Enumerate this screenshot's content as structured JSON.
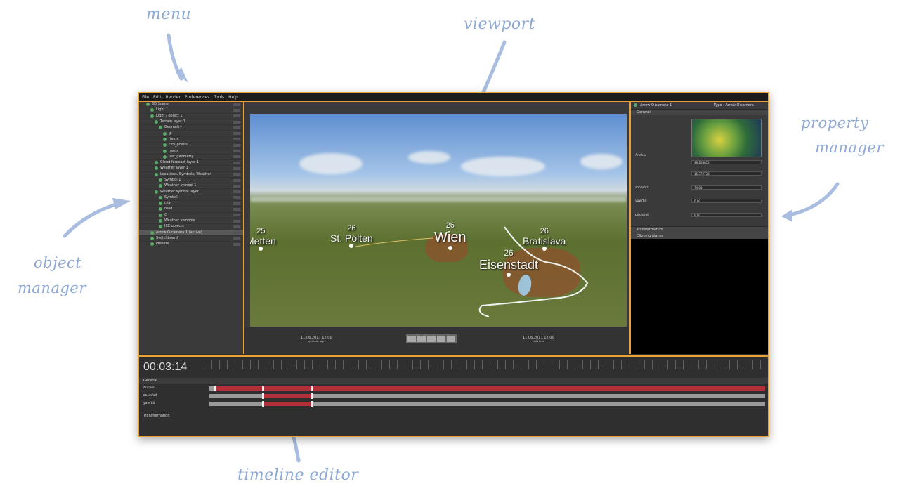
{
  "annotations": {
    "menu": "menu",
    "viewport": "viewport",
    "property_manager_line1": "property",
    "property_manager_line2": "manager",
    "object_manager_line1": "object",
    "object_manager_line2": "manager",
    "timeline_editor": "timeline editor"
  },
  "colors": {
    "highlight_border": "#e8a23a",
    "annotation": "#8fa9d6",
    "keyframe_bar": "#b3303a"
  },
  "menubar": {
    "items": [
      "File",
      "Edit",
      "Render",
      "Preferences",
      "Tools",
      "Help"
    ]
  },
  "object_manager": {
    "items": [
      "3D Scene",
      "Light 1",
      "Light / object 1",
      "Terrain layer 1",
      "Geometry",
      "gl",
      "rivers",
      "city_points",
      "roads",
      "vec_geometry",
      "Cloud forecast layer 1",
      "Weather layer 1",
      "Locations, Symbols, Weather",
      "Symbol 1",
      "Weather symbol 1",
      "Weather symbol layer",
      "Symbol",
      "city",
      "road",
      "C",
      "Weather symbols",
      "ICE objects",
      "ArrowIO camera 1 (active)",
      "Switchboard",
      "Presets"
    ],
    "selected": "ArrowIO camera 1 (active)"
  },
  "viewport": {
    "cities": [
      {
        "name": "Wien",
        "value": "26"
      },
      {
        "name": "St. Pölten",
        "value": "26"
      },
      {
        "name": "Bratislava",
        "value": "26"
      },
      {
        "name": "Eisenstadt",
        "value": "26"
      },
      {
        "name": "Metten",
        "value": "25"
      }
    ],
    "date_left": "11.06.2011  12:00",
    "date_left_sub": "synthetic sign",
    "date_right": "11.06.2011  12:00",
    "date_right_sub": "valid time"
  },
  "property_manager": {
    "object_name": "ArrowIO camera 1",
    "type_label": "Type : ArrowIO camera",
    "section_general": "General",
    "label_anchor": "Anchor",
    "anchor_lat": "48.208802",
    "anchor_lon": "16.372778",
    "label_zoom": "zoom/alt",
    "zoom_value": "74.00",
    "label_yaw": "yaw/tilt",
    "yaw_value": "0.00",
    "label_pitch": "pitch/roll",
    "pitch_value": "0.00",
    "section_transformation": "Transformation",
    "section_clipping": "Clipping planes"
  },
  "timeline": {
    "time": "00:03:14",
    "section_general": "General",
    "rows": [
      "Anchor",
      "zoom/alt",
      "yaw/tilt"
    ],
    "section_transformation": "Transformation"
  }
}
